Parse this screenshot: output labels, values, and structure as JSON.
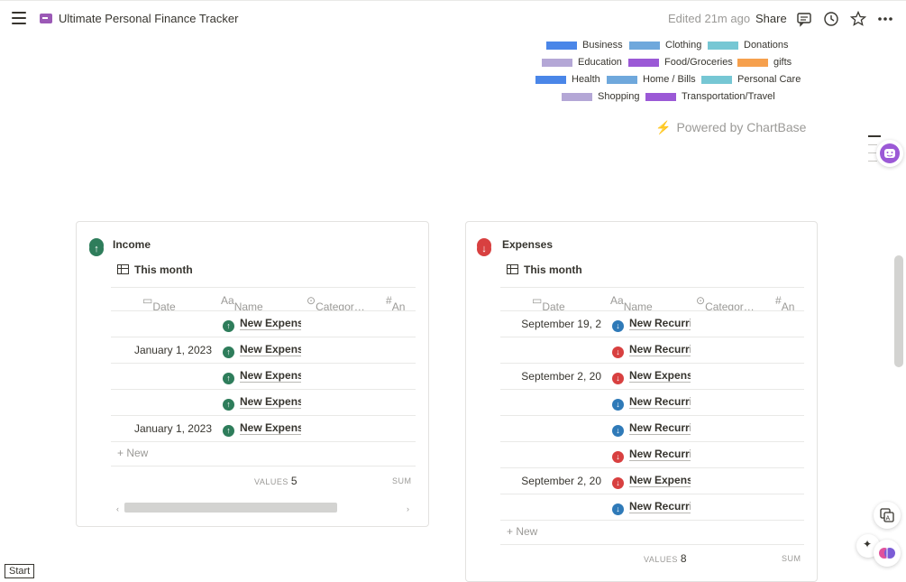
{
  "header": {
    "page_title": "Ultimate Personal Finance Tracker",
    "edited": "Edited 21m ago",
    "share": "Share"
  },
  "legend": [
    {
      "label": "Business",
      "color": "#4a86e8"
    },
    {
      "label": "Clothing",
      "color": "#6fa8dc"
    },
    {
      "label": "Donations",
      "color": "#76c7d4"
    },
    {
      "label": "Education",
      "color": "#b4a7d6"
    },
    {
      "label": "Food/Groceries",
      "color": "#9b59d6"
    },
    {
      "label": "gifts",
      "color": "#f6a04d"
    },
    {
      "label": "Health",
      "color": "#4a86e8"
    },
    {
      "label": "Home / Bills",
      "color": "#6fa8dc"
    },
    {
      "label": "Personal Care",
      "color": "#76c7d4"
    },
    {
      "label": "Shopping",
      "color": "#b4a7d6"
    },
    {
      "label": "Transportation/Travel",
      "color": "#9b59d6"
    }
  ],
  "powered_by": "Powered by ChartBase",
  "income": {
    "title": "Income",
    "view": "This month",
    "columns": [
      "Date",
      "Name",
      "Categor…",
      "An"
    ],
    "rows": [
      {
        "date": "",
        "name": "New Expens"
      },
      {
        "date": "January 1, 2023",
        "name": "New Expens"
      },
      {
        "date": "",
        "name": "New Expens"
      },
      {
        "date": "",
        "name": "New Expens"
      },
      {
        "date": "January 1, 2023",
        "name": "New Expens"
      }
    ],
    "new_label": "New",
    "values_label": "VALUES",
    "values_count": "5",
    "sum_label": "SUM"
  },
  "expenses": {
    "title": "Expenses",
    "view": "This month",
    "columns": [
      "Date",
      "Name",
      "Categor…",
      "An"
    ],
    "rows": [
      {
        "date": "September 19, 2",
        "name": "New Recurri",
        "icon": "down-blue"
      },
      {
        "date": "",
        "name": "New Recurri",
        "icon": "down-red"
      },
      {
        "date": "September 2, 20",
        "name": "New Expens",
        "icon": "down-red"
      },
      {
        "date": "",
        "name": "New Recurri",
        "icon": "down-blue"
      },
      {
        "date": "",
        "name": "New Recurri",
        "icon": "down-blue"
      },
      {
        "date": "",
        "name": "New Recurri",
        "icon": "down-red"
      },
      {
        "date": "September 2, 20",
        "name": "New Expens",
        "icon": "down-red"
      },
      {
        "date": "",
        "name": "New Recurri",
        "icon": "down-blue"
      }
    ],
    "new_label": "New",
    "values_label": "VALUES",
    "values_count": "8",
    "sum_label": "SUM"
  },
  "start_button": "Start"
}
